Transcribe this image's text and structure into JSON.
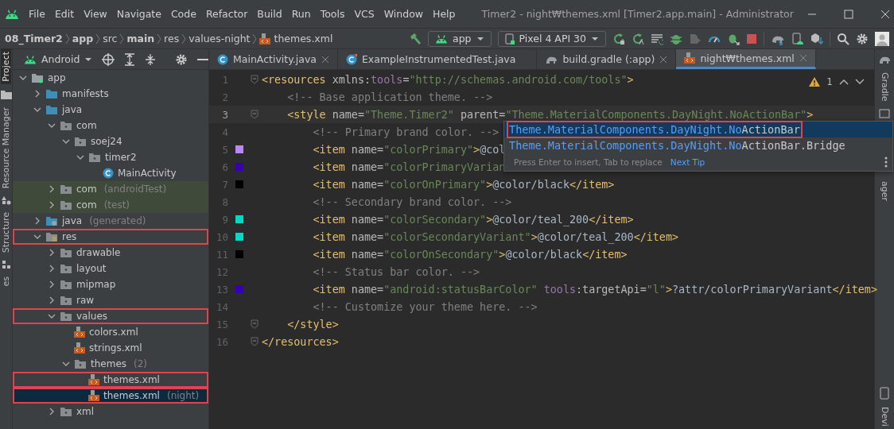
{
  "window": {
    "title": "Timer2 - night₩themes.xml [Timer2.app.main] - Administrator"
  },
  "menu": [
    "File",
    "Edit",
    "View",
    "Navigate",
    "Code",
    "Refactor",
    "Build",
    "Run",
    "Tools",
    "VCS",
    "Window",
    "Help"
  ],
  "breadcrumbs": [
    {
      "label": "08_Timer2",
      "bold": true
    },
    {
      "label": "app",
      "bold": true
    },
    {
      "label": "src",
      "bold": false
    },
    {
      "label": "main",
      "bold": true
    },
    {
      "label": "res",
      "bold": false
    },
    {
      "label": "values-night",
      "bold": false
    },
    {
      "label": "themes.xml",
      "bold": false,
      "kind": "xml"
    }
  ],
  "run_config": "app",
  "device": "Pixel 4 API 30",
  "left_strip": [
    {
      "label": "Project",
      "selected": true
    },
    {
      "label": "Resource Manager",
      "selected": false
    },
    {
      "label": "Structure",
      "selected": false
    },
    {
      "label": "es",
      "selected": false
    }
  ],
  "right_strip": [
    "Gradle",
    "ager",
    "Devi"
  ],
  "project_view": "Android",
  "tree": [
    {
      "label": "app",
      "kind": "module",
      "expanded": true,
      "selected": false,
      "marked": false,
      "children": [
        {
          "label": "manifests",
          "kind": "source",
          "expanded": false,
          "selected": false,
          "marked": false
        },
        {
          "label": "java",
          "kind": "source",
          "expanded": true,
          "selected": false,
          "marked": false,
          "children": [
            {
              "label": "com",
              "kind": "package",
              "expanded": true,
              "selected": false,
              "marked": false,
              "children": [
                {
                  "label": "soej24",
                  "kind": "package",
                  "expanded": true,
                  "selected": false,
                  "marked": false,
                  "children": [
                    {
                      "label": "timer2",
                      "kind": "package",
                      "expanded": true,
                      "selected": false,
                      "marked": false,
                      "children": [
                        {
                          "label": "MainActivity",
                          "kind": "class",
                          "selected": false,
                          "marked": false
                        }
                      ]
                    }
                  ]
                }
              ]
            },
            {
              "label": "com",
              "suffix": "(androidTest)",
              "kind": "test-package",
              "expanded": false,
              "selected": false,
              "marked": false
            },
            {
              "label": "com",
              "suffix": "(test)",
              "kind": "test-package",
              "expanded": false,
              "selected": false,
              "marked": false
            }
          ]
        },
        {
          "label": "java",
          "suffix": "(generated)",
          "kind": "generated",
          "expanded": false,
          "selected": false,
          "marked": false
        },
        {
          "label": "res",
          "kind": "res",
          "expanded": true,
          "selected": false,
          "marked": true,
          "children": [
            {
              "label": "drawable",
              "kind": "package",
              "expanded": false,
              "selected": false,
              "marked": false
            },
            {
              "label": "layout",
              "kind": "package",
              "expanded": false,
              "selected": false,
              "marked": false
            },
            {
              "label": "mipmap",
              "kind": "package",
              "expanded": false,
              "selected": false,
              "marked": false
            },
            {
              "label": "raw",
              "kind": "package",
              "expanded": false,
              "selected": false,
              "marked": false
            },
            {
              "label": "values",
              "kind": "package",
              "expanded": true,
              "selected": false,
              "marked": true,
              "children": [
                {
                  "label": "colors.xml",
                  "kind": "xml",
                  "selected": false,
                  "marked": false
                },
                {
                  "label": "strings.xml",
                  "kind": "xml",
                  "selected": false,
                  "marked": false
                },
                {
                  "label": "themes",
                  "suffix": "(2)",
                  "kind": "package",
                  "expanded": true,
                  "selected": false,
                  "marked": false,
                  "children": [
                    {
                      "label": "themes.xml",
                      "kind": "xml",
                      "selected": false,
                      "marked": true
                    },
                    {
                      "label": "themes.xml",
                      "suffix": "(night)",
                      "kind": "xml",
                      "selected": true,
                      "marked": true
                    }
                  ]
                }
              ]
            },
            {
              "label": "xml",
              "kind": "package",
              "expanded": false,
              "selected": false,
              "marked": false
            }
          ]
        }
      ]
    }
  ],
  "tabs": [
    {
      "label": "MainActivity.java",
      "kind": "class",
      "selected": false,
      "closable": true
    },
    {
      "label": "ExampleInstrumentedTest.java",
      "kind": "test-class",
      "selected": false,
      "closable": false
    },
    {
      "label": "build.gradle (:app)",
      "kind": "gradle",
      "selected": false,
      "closable": true
    },
    {
      "label": "night₩themes.xml",
      "kind": "xml",
      "selected": true,
      "closable": true
    }
  ],
  "warnings": "1",
  "lines": [
    {
      "number": "1",
      "fold": true,
      "current": false,
      "tokens": [
        {
          "kind": "tag",
          "text": "<resources"
        },
        {
          "kind": "attr",
          "text": " xmlns:"
        },
        {
          "kind": "ns",
          "text": "tools"
        },
        {
          "kind": "attr",
          "text": "="
        },
        {
          "kind": "value",
          "text": "\"http://schemas.android.com/tools\""
        },
        {
          "kind": "tag",
          "text": ">"
        }
      ]
    },
    {
      "number": "2",
      "fold": false,
      "current": false,
      "tokens": [
        {
          "kind": "comment",
          "text": "    <!-- Base application theme. -->"
        }
      ]
    },
    {
      "number": "3",
      "fold": true,
      "current": true,
      "tokens": [
        {
          "kind": "tag",
          "text": "    <style"
        },
        {
          "kind": "attr",
          "text": " name="
        },
        {
          "kind": "value",
          "text": "\"Theme.Timer2\""
        },
        {
          "kind": "attr",
          "text": " parent="
        },
        {
          "kind": "value",
          "text": "\"Theme.MaterialComponents.DayNight.NoActionBar\""
        },
        {
          "kind": "tag",
          "text": ">"
        }
      ]
    },
    {
      "number": "4",
      "fold": false,
      "current": false,
      "tokens": [
        {
          "kind": "comment",
          "text": "        <!-- Primary brand color. -->"
        }
      ]
    },
    {
      "number": "5",
      "fold": false,
      "current": false,
      "color": "#bb86fc",
      "tokens": [
        {
          "kind": "tag",
          "text": "        <item"
        },
        {
          "kind": "attr",
          "text": " name="
        },
        {
          "kind": "value",
          "text": "\"colorPrimary\""
        },
        {
          "kind": "tag",
          "text": ">"
        },
        {
          "kind": "text",
          "text": "@col"
        }
      ]
    },
    {
      "number": "6",
      "fold": false,
      "current": false,
      "color": "#3700b3",
      "tokens": [
        {
          "kind": "tag",
          "text": "        <item"
        },
        {
          "kind": "attr",
          "text": " name="
        },
        {
          "kind": "value",
          "text": "\"colorPrimaryVarian"
        }
      ]
    },
    {
      "number": "7",
      "fold": false,
      "current": false,
      "color": "#000000",
      "tokens": [
        {
          "kind": "tag",
          "text": "        <item"
        },
        {
          "kind": "attr",
          "text": " name="
        },
        {
          "kind": "value",
          "text": "\"colorOnPrimary\""
        },
        {
          "kind": "tag",
          "text": ">"
        },
        {
          "kind": "text",
          "text": "@color/black"
        },
        {
          "kind": "tag",
          "text": "</item>"
        }
      ]
    },
    {
      "number": "8",
      "fold": false,
      "current": false,
      "tokens": [
        {
          "kind": "comment",
          "text": "        <!-- Secondary brand color. -->"
        }
      ]
    },
    {
      "number": "9",
      "fold": false,
      "current": false,
      "color": "#03dac5",
      "tokens": [
        {
          "kind": "tag",
          "text": "        <item"
        },
        {
          "kind": "attr",
          "text": " name="
        },
        {
          "kind": "value",
          "text": "\"colorSecondary\""
        },
        {
          "kind": "tag",
          "text": ">"
        },
        {
          "kind": "text",
          "text": "@color/teal_200"
        },
        {
          "kind": "tag",
          "text": "</item>"
        }
      ]
    },
    {
      "number": "10",
      "fold": false,
      "current": false,
      "color": "#03dac5",
      "tokens": [
        {
          "kind": "tag",
          "text": "        <item"
        },
        {
          "kind": "attr",
          "text": " name="
        },
        {
          "kind": "value",
          "text": "\"colorSecondaryVariant\""
        },
        {
          "kind": "tag",
          "text": ">"
        },
        {
          "kind": "text",
          "text": "@color/teal_200"
        },
        {
          "kind": "tag",
          "text": "</item>"
        }
      ]
    },
    {
      "number": "11",
      "fold": false,
      "current": false,
      "color": "#000000",
      "tokens": [
        {
          "kind": "tag",
          "text": "        <item"
        },
        {
          "kind": "attr",
          "text": " name="
        },
        {
          "kind": "value",
          "text": "\"colorOnSecondary\""
        },
        {
          "kind": "tag",
          "text": ">"
        },
        {
          "kind": "text",
          "text": "@color/black"
        },
        {
          "kind": "tag",
          "text": "</item>"
        }
      ]
    },
    {
      "number": "12",
      "fold": false,
      "current": false,
      "tokens": [
        {
          "kind": "comment",
          "text": "        <!-- Status bar color. -->"
        }
      ]
    },
    {
      "number": "13",
      "fold": false,
      "current": false,
      "color": "#3700b3",
      "tokens": [
        {
          "kind": "tag",
          "text": "        <item"
        },
        {
          "kind": "attr",
          "text": " name="
        },
        {
          "kind": "value",
          "text": "\"android:statusBarColor\" "
        },
        {
          "kind": "ns",
          "text": "tools"
        },
        {
          "kind": "attr",
          "text": ":targetApi="
        },
        {
          "kind": "value",
          "text": "\"l\""
        },
        {
          "kind": "tag",
          "text": ">"
        },
        {
          "kind": "text",
          "text": "?attr/colorPrimaryVariant"
        },
        {
          "kind": "tag",
          "text": "</item>"
        }
      ]
    },
    {
      "number": "14",
      "fold": false,
      "current": false,
      "tokens": [
        {
          "kind": "comment",
          "text": "        <!-- Customize your theme here. -->"
        }
      ]
    },
    {
      "number": "15",
      "fold": true,
      "current": false,
      "tokens": [
        {
          "kind": "tag",
          "text": "    </style>"
        }
      ]
    },
    {
      "number": "16",
      "fold": true,
      "current": false,
      "tokens": [
        {
          "kind": "tag",
          "text": "</resources>"
        }
      ]
    }
  ],
  "completion": {
    "items": [
      {
        "match": "Theme.MaterialComponents.DayNight.No",
        "rest": "ActionBar",
        "selected": true,
        "marked": true
      },
      {
        "match": "Theme.MaterialComponents.DayNight.No",
        "rest": "ActionBar.Bridge",
        "selected": false,
        "marked": false
      }
    ],
    "hint": "Press Enter to insert, Tab to replace",
    "link": "Next Tip"
  }
}
